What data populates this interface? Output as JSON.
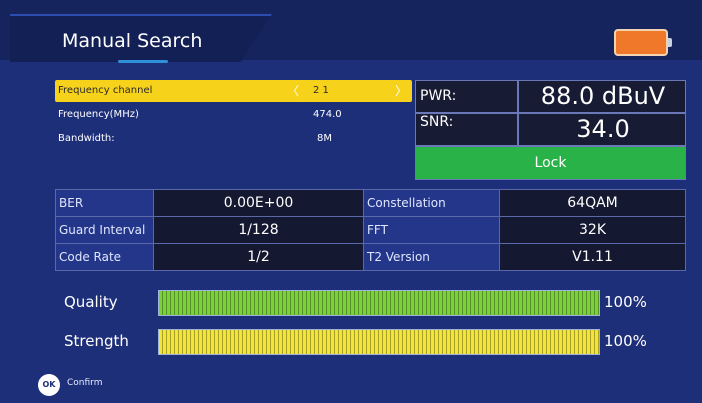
{
  "header": {
    "title": "Manual Search"
  },
  "battery": {
    "icon": "battery-icon",
    "color": "#f0782a"
  },
  "params": {
    "frequency_channel": {
      "label": "Frequency channel",
      "value": "2 1",
      "left_arrow": "〈",
      "right_arrow": "〉"
    },
    "frequency": {
      "label": "Frequency(MHz)",
      "value": "474.0"
    },
    "bandwidth": {
      "label": "Bandwidth:",
      "value": "8M"
    }
  },
  "meter": {
    "pwr_label": "PWR:",
    "pwr_value": "88.0 dBuV",
    "snr_label": "SNR:",
    "snr_value": "34.0",
    "lock_label": "Lock",
    "lock_color": "#28b247"
  },
  "info": {
    "ber_label": "BER",
    "ber_value": "0.00E+00",
    "constellation_label": "Constellation",
    "constellation_value": "64QAM",
    "guard_label": "Guard Interval",
    "guard_value": "1/128",
    "fft_label": "FFT",
    "fft_value": "32K",
    "code_rate_label": "Code Rate",
    "code_rate_value": "1/2",
    "t2_label": "T2 Version",
    "t2_value": "V1.11"
  },
  "quality": {
    "label": "Quality",
    "percent_text": "100%",
    "level": 1.0,
    "color": "#7bd13a"
  },
  "strength": {
    "label": "Strength",
    "percent_text": "100%",
    "level": 1.0,
    "color": "#f2e43a"
  },
  "footer": {
    "ok_icon_text": "OK",
    "confirm_label": "Confirm"
  }
}
